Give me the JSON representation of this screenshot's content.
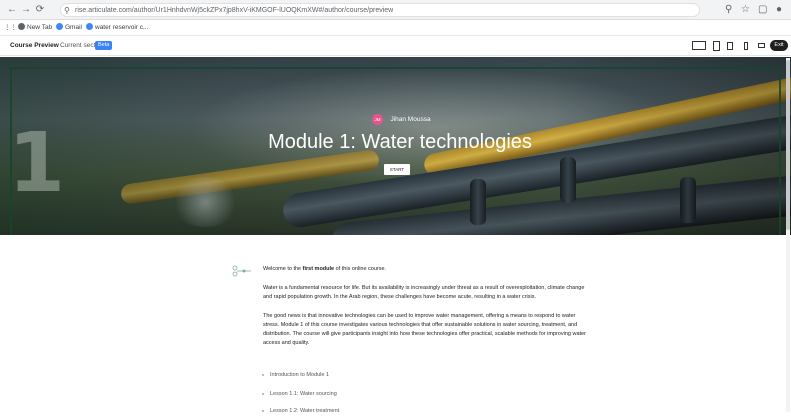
{
  "browser": {
    "url": "rise.articulate.com/author/Ur1HnhdvnWj5ckZPx7jp8hxV-iKMGOF-lUOQKmXW#/author/course/preview",
    "bookmarks": [
      "New Tab",
      "Gmail",
      "water reservoir c..."
    ]
  },
  "app": {
    "title": "Course Preview",
    "subtitle": "Current section",
    "badge": "Beta",
    "exit_label": "Exit"
  },
  "hero": {
    "number": "1",
    "author_initials": "JM",
    "author_name": "Jihan Moussa",
    "title": "Module 1: Water technologies",
    "start_label": "START"
  },
  "content": {
    "welcome_prefix": "Welcome to the ",
    "welcome_bold": "first module",
    "welcome_suffix": " of this online course.",
    "para1": "Water is a fundamental resource for life. But its availability is increasingly under threat as a result of overexploitation, climate change and rapid population growth. In the Arab region, these challenges have become acute, resulting in a water crisis.",
    "para2": "The good news is that innovative technologies can be used to improve water management, offering a means to respond to water stress. Module 1 of this course investigates various technologies that offer sustainable solutions in water sourcing, treatment, and distribution. The course will give participants insight into how these technologies offer practical, scalable methods for improving water access and quality.",
    "lessons": [
      "Introduction to Module 1",
      "Lesson 1.1: Water sourcing",
      "Lesson 1.2: Water treatment"
    ]
  },
  "colors": {
    "accent": "#3b82f6",
    "avatar": "#e5558b",
    "frame": "#14462a"
  }
}
